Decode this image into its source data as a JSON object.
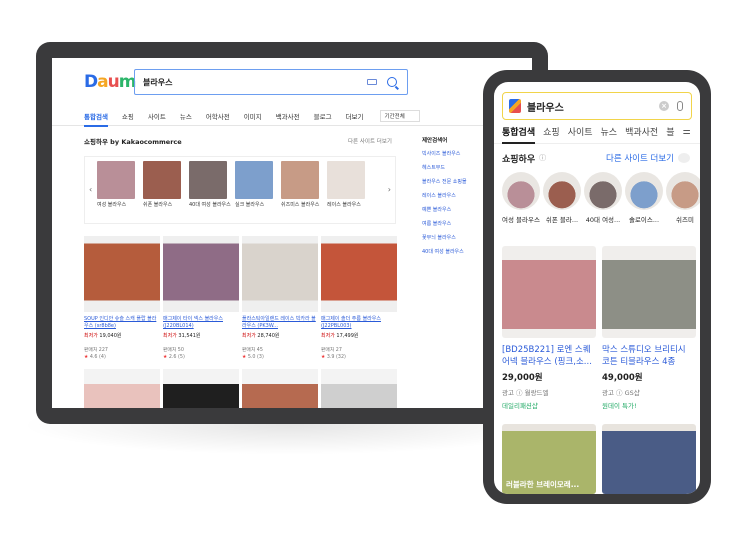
{
  "desktop": {
    "logo": [
      "D",
      "a",
      "u",
      "m"
    ],
    "search_query": "블라우스",
    "tabs": [
      "통합검색",
      "쇼핑",
      "사이트",
      "뉴스",
      "어학사전",
      "이미지",
      "백과사전",
      "블로그",
      "더보기"
    ],
    "period_select": "기간전체",
    "shopping_title": "쇼핑하우 by Kakaocommerce",
    "shopping_more": "다른 사이트 더보기",
    "chips": [
      {
        "label": "여성 블라우스",
        "color": "#b98f98"
      },
      {
        "label": "쉬폰 블라우스",
        "color": "#9b5e4f"
      },
      {
        "label": "40대 여성 블라우스",
        "color": "#7a6b6a"
      },
      {
        "label": "실크 블라우스",
        "color": "#7d9fcc"
      },
      {
        "label": "쉬즈미스 블라우스",
        "color": "#c79b86"
      },
      {
        "label": "레이스 블라우스",
        "color": "#e8e0da"
      }
    ],
    "products": [
      {
        "name": "SOUP 인디안 슈슬 스캐 플랍 블라우스 (sr8b8e)",
        "price_label": "최저가",
        "price": "19,040원",
        "sellers_label": "판매처",
        "sellers": "227",
        "rating": "4.6",
        "reviews": "(4)",
        "color": "#b55c3c"
      },
      {
        "name": "매그제이 타이 넥스 블라우스 (J220BL014)",
        "price_label": "최저가",
        "price": "31,541원",
        "sellers_label": "판매처",
        "sellers": "50",
        "rating": "2.6",
        "reviews": "(5)",
        "color": "#8f6c86"
      },
      {
        "name": "플라스틱아일랜드 레이스 빅카라 블라우스 (PK3W...",
        "price_label": "최저가",
        "price": "28,740원",
        "sellers_label": "판매처",
        "sellers": "45",
        "rating": "5.0",
        "reviews": "(3)",
        "color": "#d9d3cc"
      },
      {
        "name": "매그제이 솔더 주름 블라우스 (J22PBL003)",
        "price_label": "최저가",
        "price": "17,499원",
        "sellers_label": "판매처",
        "sellers": "27",
        "rating": "3.9",
        "reviews": "(32)",
        "color": "#c4553a"
      }
    ],
    "products_row2_colors": [
      "#e9c2bd",
      "#1f1f1f",
      "#b66a50",
      "#cfcfcf"
    ],
    "related_title": "제안검색어",
    "related": [
      "빅사이즈 블라우스",
      "헤스트무드",
      "블라우스 전문 쇼핑몰",
      "레이스 블라우스",
      "예쁜 블라우스",
      "여름 블라우스",
      "꽃무늬 블라우스",
      "40대 여성 블라우스"
    ]
  },
  "mobile": {
    "search_query": "블라우스",
    "tabs": [
      "통합검색",
      "쇼핑",
      "사이트",
      "뉴스",
      "백과사전",
      "블"
    ],
    "shopping_title": "쇼핑하우",
    "shopping_more": "다른 사이트 더보기",
    "circles": [
      {
        "label": "여성 블라우스",
        "color": "#b98f98"
      },
      {
        "label": "쉬폰 블라...",
        "color": "#9b5e4f"
      },
      {
        "label": "40대 여성...",
        "color": "#7a6b6a"
      },
      {
        "label": "솔로이스...",
        "color": "#7d9fcc"
      },
      {
        "label": "쉬즈미",
        "color": "#c79b86"
      }
    ],
    "products": [
      {
        "name": "[BD25B221] 로엔 스퀘어넥 블라우스 (핑크,소...",
        "price": "29,000원",
        "ad": "광고 ⓘ 월랑드엘",
        "coupon": "데일리패션샵",
        "color": "#c98a8e"
      },
      {
        "name": "막스 스튜디오 브리티시 코튼 티블라우스 4종",
        "price": "49,000원",
        "ad": "광고 ⓘ GS샵",
        "coupon": "원데이 특가!",
        "color": "#8d8f86"
      }
    ],
    "products_row2": [
      {
        "caption": "러블라한 브레이모래...",
        "color": "#aab56a"
      },
      {
        "caption": "",
        "color": "#4a5c86"
      }
    ]
  }
}
